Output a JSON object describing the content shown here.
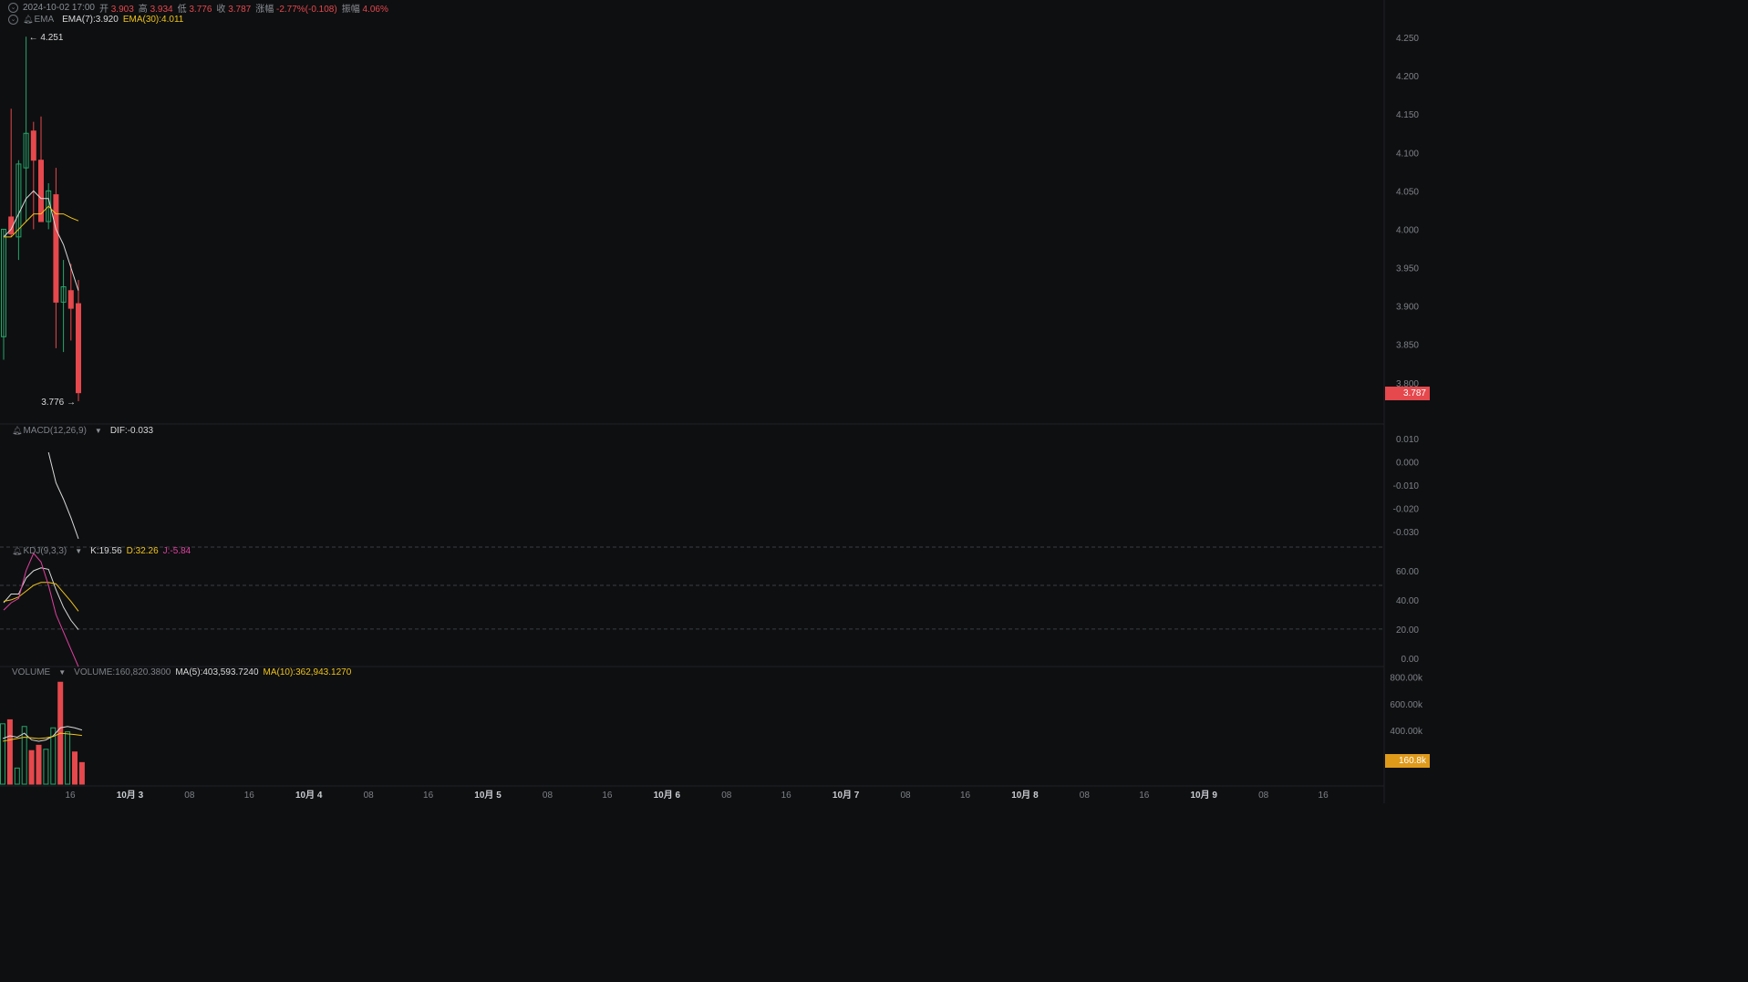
{
  "header": {
    "datetime": "2024-10-02 17:00",
    "open_label": "开",
    "open": "3.903",
    "high_label": "高",
    "high": "3.934",
    "low_label": "低",
    "low": "3.776",
    "close_label": "收",
    "close": "3.787",
    "change_label": "涨幅",
    "change": "-2.77%(-0.108)",
    "amplitude_label": "振幅",
    "amplitude": "4.06%"
  },
  "ema_legend": {
    "name": "EMA",
    "ema7": "EMA(7):3.920",
    "ema30": "EMA(30):4.011"
  },
  "macd_legend": {
    "name": "MACD(12,26,9)",
    "dif": "DIF:-0.033"
  },
  "kdj_legend": {
    "name": "KDJ(9,3,3)",
    "k": "K:19.56",
    "d": "D:32.26",
    "j": "J:-5.84"
  },
  "volume_legend": {
    "name": "VOLUME",
    "volume": "VOLUME:160,820.3800",
    "ma5": "MA(5):403,593.7240",
    "ma10": "MA(10):362,943.1270"
  },
  "price_tag": "3.787",
  "volume_tag": "160.8k",
  "colors": {
    "up": "#26a66a",
    "down": "#e5484d",
    "background": "#0e0f11",
    "ema7": "#d9d9d9",
    "ema30": "#f0c419",
    "k": "#d9d9d9",
    "d": "#f0c419",
    "j": "#e040a0"
  },
  "chart_data": [
    {
      "type": "candlestick",
      "panel": "price",
      "yticks": [
        "4.250",
        "4.200",
        "4.150",
        "4.100",
        "4.050",
        "4.000",
        "3.950",
        "3.900",
        "3.850",
        "3.800"
      ],
      "ylim": [
        3.77,
        4.275
      ],
      "max_label": "← 4.251",
      "min_label": "3.776 →",
      "max_value": 4.251,
      "min_value": 3.776,
      "candles": [
        {
          "o": 3.86,
          "h": 4.0,
          "l": 3.83,
          "c": 4.0
        },
        {
          "o": 4.016,
          "h": 4.157,
          "l": 3.99,
          "c": 3.994
        },
        {
          "o": 3.99,
          "h": 4.09,
          "l": 3.96,
          "c": 4.085
        },
        {
          "o": 4.08,
          "h": 4.251,
          "l": 4.01,
          "c": 4.125
        },
        {
          "o": 4.128,
          "h": 4.14,
          "l": 4.0,
          "c": 4.09
        },
        {
          "o": 4.09,
          "h": 4.147,
          "l": 4.01,
          "c": 4.01
        },
        {
          "o": 4.01,
          "h": 4.06,
          "l": 4.0,
          "c": 4.05
        },
        {
          "o": 4.045,
          "h": 4.08,
          "l": 3.845,
          "c": 3.905
        },
        {
          "o": 3.905,
          "h": 3.96,
          "l": 3.84,
          "c": 3.925
        },
        {
          "o": 3.92,
          "h": 3.955,
          "l": 3.855,
          "c": 3.897
        },
        {
          "o": 3.903,
          "h": 3.934,
          "l": 3.776,
          "c": 3.787
        }
      ],
      "series": [
        {
          "name": "EMA(7)",
          "values": [
            3.99,
            4.0,
            4.02,
            4.04,
            4.05,
            4.04,
            4.04,
            4.0,
            3.98,
            3.95,
            3.92
          ]
        },
        {
          "name": "EMA(30)",
          "values": [
            3.99,
            3.99,
            4.0,
            4.01,
            4.02,
            4.02,
            4.03,
            4.02,
            4.02,
            4.015,
            4.011
          ]
        }
      ]
    },
    {
      "type": "line",
      "panel": "macd",
      "yticks": [
        "0.010",
        "0.000",
        "-0.010",
        "-0.020",
        "-0.030"
      ],
      "ylim": [
        -0.035,
        0.015
      ],
      "series": [
        {
          "name": "DIF",
          "start_index": 6,
          "values": [
            0.004,
            -0.009,
            -0.016,
            -0.024,
            -0.033
          ]
        }
      ]
    },
    {
      "type": "line",
      "panel": "kdj",
      "yticks": [
        "60.00",
        "40.00",
        "20.00",
        "0.00"
      ],
      "ylim": [
        -2,
        70
      ],
      "reference_lines": [
        50,
        20
      ],
      "series": [
        {
          "name": "K",
          "values": [
            38,
            44,
            44,
            55,
            60,
            62,
            61,
            47,
            35,
            26,
            19.56
          ]
        },
        {
          "name": "D",
          "values": [
            39,
            40,
            42,
            46,
            50,
            52,
            52,
            51,
            45,
            39,
            32.26
          ]
        },
        {
          "name": "J",
          "values": [
            33,
            38,
            41,
            60,
            72,
            66,
            50,
            30,
            18,
            6,
            -5.84
          ]
        }
      ]
    },
    {
      "type": "bar",
      "panel": "volume",
      "yticks": [
        "800.00k",
        "600.00k",
        "400.00k",
        "200.00k"
      ],
      "ylim": [
        0,
        850000
      ],
      "values": [
        450000,
        480000,
        120000,
        430000,
        250000,
        290000,
        260000,
        420000,
        760000,
        390000,
        240000,
        160820
      ],
      "directions": [
        "up",
        "down",
        "up",
        "up",
        "down",
        "down",
        "up",
        "up",
        "down",
        "up",
        "down",
        "down"
      ],
      "series": [
        {
          "name": "MA(5)",
          "values": [
            340000,
            360000,
            350000,
            380000,
            330000,
            320000,
            330000,
            360000,
            420000,
            430000,
            420000,
            403594
          ]
        },
        {
          "name": "MA(10)",
          "values": [
            320000,
            330000,
            340000,
            350000,
            345000,
            340000,
            345000,
            355000,
            380000,
            375000,
            370000,
            362943
          ]
        }
      ]
    },
    {
      "type": "time-axis",
      "labels": [
        "16",
        "10月 3",
        "08",
        "16",
        "10月 4",
        "08",
        "16",
        "10月 5",
        "08",
        "16",
        "10月 6",
        "08",
        "16",
        "10月 7",
        "08",
        "16",
        "10月 8",
        "08",
        "16",
        "10月 9",
        "08",
        "16"
      ],
      "bold_labels": [
        "10月 3",
        "10月 4",
        "10月 5",
        "10月 6",
        "10月 7",
        "10月 8",
        "10月 9"
      ]
    }
  ]
}
